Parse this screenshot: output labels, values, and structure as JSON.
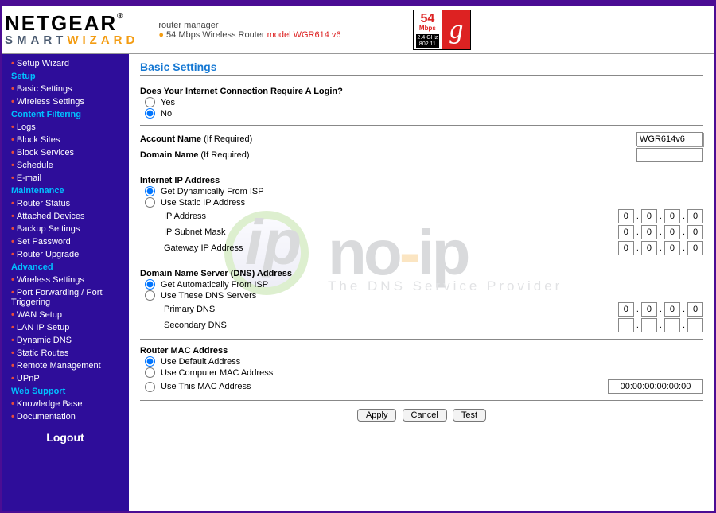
{
  "header": {
    "brand": "NETGEAR",
    "subbrand_smart": "SMART",
    "subbrand_wizard": "WIZARD",
    "tagline": "router manager",
    "desc_prefix": "54 Mbps Wireless Router ",
    "model": "model WGR614 v6",
    "badge": {
      "num": "54",
      "unit": "Mbps",
      "ghz": "2.4 GHz",
      "std": "802.11",
      "g": "g"
    }
  },
  "sidebar": {
    "groups": [
      {
        "type": "item",
        "label": "Setup Wizard"
      },
      {
        "type": "head",
        "label": "Setup"
      },
      {
        "type": "item",
        "label": "Basic Settings"
      },
      {
        "type": "item",
        "label": "Wireless Settings"
      },
      {
        "type": "head",
        "label": "Content Filtering"
      },
      {
        "type": "item",
        "label": "Logs"
      },
      {
        "type": "item",
        "label": "Block Sites"
      },
      {
        "type": "item",
        "label": "Block Services"
      },
      {
        "type": "item",
        "label": "Schedule"
      },
      {
        "type": "item",
        "label": "E-mail"
      },
      {
        "type": "head",
        "label": "Maintenance"
      },
      {
        "type": "item",
        "label": "Router Status"
      },
      {
        "type": "item",
        "label": "Attached Devices"
      },
      {
        "type": "item",
        "label": "Backup Settings"
      },
      {
        "type": "item",
        "label": "Set Password"
      },
      {
        "type": "item",
        "label": "Router Upgrade"
      },
      {
        "type": "head",
        "label": "Advanced"
      },
      {
        "type": "item",
        "label": "Wireless Settings"
      },
      {
        "type": "item",
        "label": "Port Forwarding / Port Triggering"
      },
      {
        "type": "item",
        "label": "WAN Setup"
      },
      {
        "type": "item",
        "label": "LAN IP Setup"
      },
      {
        "type": "item",
        "label": "Dynamic DNS"
      },
      {
        "type": "item",
        "label": "Static Routes"
      },
      {
        "type": "item",
        "label": "Remote Management"
      },
      {
        "type": "item",
        "label": "UPnP"
      },
      {
        "type": "head",
        "label": "Web Support"
      },
      {
        "type": "item",
        "label": "Knowledge Base"
      },
      {
        "type": "item",
        "label": "Documentation"
      }
    ],
    "logout": "Logout"
  },
  "page": {
    "title": "Basic Settings",
    "login_q": "Does Your Internet Connection Require A Login?",
    "yes": "Yes",
    "no": "No",
    "login_selected": "no",
    "account_label": "Account Name",
    "if_req": "(If Required)",
    "account_value": "WGR614v6",
    "domain_label": "Domain Name",
    "domain_value": "",
    "iip_header": "Internet IP Address",
    "iip_dyn": "Get Dynamically From ISP",
    "iip_stat": "Use Static IP Address",
    "iip_selected": "dynamic",
    "ipaddr_label": "IP Address",
    "subnet_label": "IP Subnet Mask",
    "gateway_label": "Gateway IP Address",
    "ip_values": {
      "ip": [
        "0",
        "0",
        "0",
        "0"
      ],
      "subnet": [
        "0",
        "0",
        "0",
        "0"
      ],
      "gateway": [
        "0",
        "0",
        "0",
        "0"
      ]
    },
    "dns_header": "Domain Name Server (DNS) Address",
    "dns_auto": "Get Automatically From ISP",
    "dns_use": "Use These DNS Servers",
    "dns_selected": "auto",
    "primary_label": "Primary DNS",
    "secondary_label": "Secondary DNS",
    "dns_values": {
      "primary": [
        "0",
        "0",
        "0",
        "0"
      ],
      "secondary": [
        "",
        "",
        "",
        ""
      ]
    },
    "mac_header": "Router MAC Address",
    "mac_default": "Use Default Address",
    "mac_computer": "Use Computer MAC Address",
    "mac_this": "Use This MAC Address",
    "mac_selected": "default",
    "mac_value": "00:00:00:00:00:00",
    "btn_apply": "Apply",
    "btn_cancel": "Cancel",
    "btn_test": "Test"
  },
  "watermark": {
    "big": "no",
    "dash": "-",
    "ip": "ip",
    "tag": "The DNS Service Provider"
  }
}
